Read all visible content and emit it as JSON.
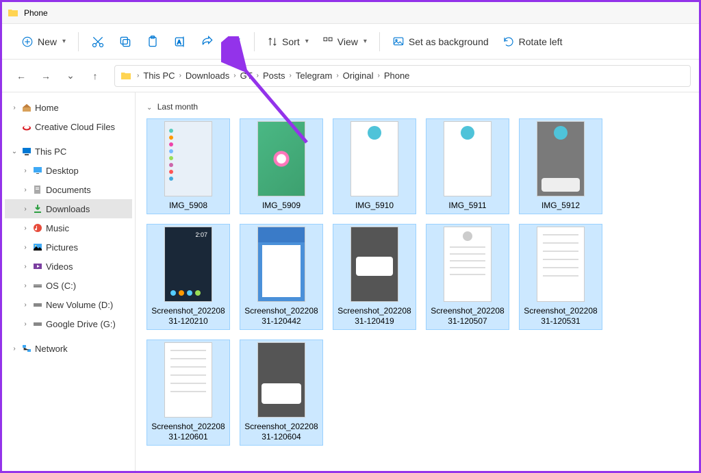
{
  "title": "Phone",
  "toolbar": {
    "new_label": "New",
    "sort_label": "Sort",
    "view_label": "View",
    "background_label": "Set as background",
    "rotate_label": "Rotate left"
  },
  "breadcrumb": [
    "This PC",
    "Downloads",
    "GT",
    "Posts",
    "Telegram",
    "Original",
    "Phone"
  ],
  "sidebar": {
    "home": "Home",
    "creative_cloud": "Creative Cloud Files",
    "this_pc": "This PC",
    "desktop": "Desktop",
    "documents": "Documents",
    "downloads": "Downloads",
    "music": "Music",
    "pictures": "Pictures",
    "videos": "Videos",
    "os_c": "OS (C:)",
    "new_volume": "New Volume (D:)",
    "google_drive": "Google Drive (G:)",
    "network": "Network"
  },
  "group_header": "Last month",
  "files": [
    {
      "name": "IMG_5908"
    },
    {
      "name": "IMG_5909"
    },
    {
      "name": "IMG_5910"
    },
    {
      "name": "IMG_5911"
    },
    {
      "name": "IMG_5912"
    },
    {
      "name": "Screenshot_20220831-120210"
    },
    {
      "name": "Screenshot_20220831-120442"
    },
    {
      "name": "Screenshot_20220831-120419"
    },
    {
      "name": "Screenshot_20220831-120507"
    },
    {
      "name": "Screenshot_20220831-120531"
    },
    {
      "name": "Screenshot_20220831-120601"
    },
    {
      "name": "Screenshot_20220831-120604"
    }
  ],
  "clock_time": "2:07"
}
